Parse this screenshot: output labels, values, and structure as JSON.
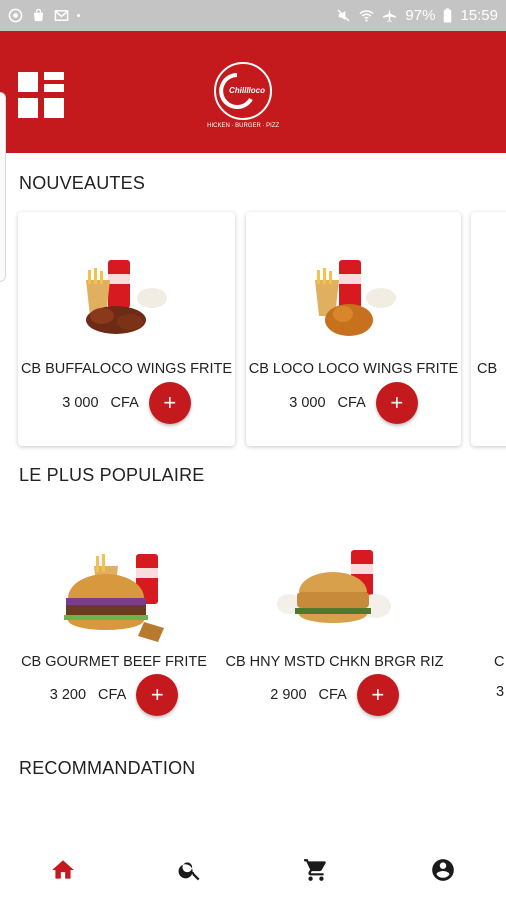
{
  "status_bar": {
    "battery": "97%",
    "time": "15:59"
  },
  "brand": {
    "logo_text": "Chilllloco",
    "logo_tagline": "CHICKEN · BURGER · PIZZA",
    "accent": "#c41a1e"
  },
  "sections": {
    "new": {
      "title": "NOUVEAUTES",
      "items": [
        {
          "name": "CB BUFFALOCO WINGS FRITE",
          "price": "3 000",
          "currency": "CFA"
        },
        {
          "name": "CB LOCO LOCO WINGS FRITE",
          "price": "3 000",
          "currency": "CFA"
        },
        {
          "name": "CB"
        }
      ]
    },
    "popular": {
      "title": "LE PLUS POPULAIRE",
      "items": [
        {
          "name": "CB GOURMET BEEF FRITE",
          "price": "3 200",
          "currency": "CFA"
        },
        {
          "name": "CB HNY MSTD CHKN BRGR RIZ",
          "price": "2 900",
          "currency": "CFA"
        },
        {
          "name": "C",
          "price": "3"
        }
      ]
    },
    "recommend": {
      "title": "RECOMMANDATION"
    }
  },
  "add_label": "+",
  "bottom_nav": [
    {
      "icon": "home-icon",
      "active": true
    },
    {
      "icon": "search-icon",
      "active": false
    },
    {
      "icon": "cart-icon",
      "active": false
    },
    {
      "icon": "account-icon",
      "active": false
    }
  ]
}
